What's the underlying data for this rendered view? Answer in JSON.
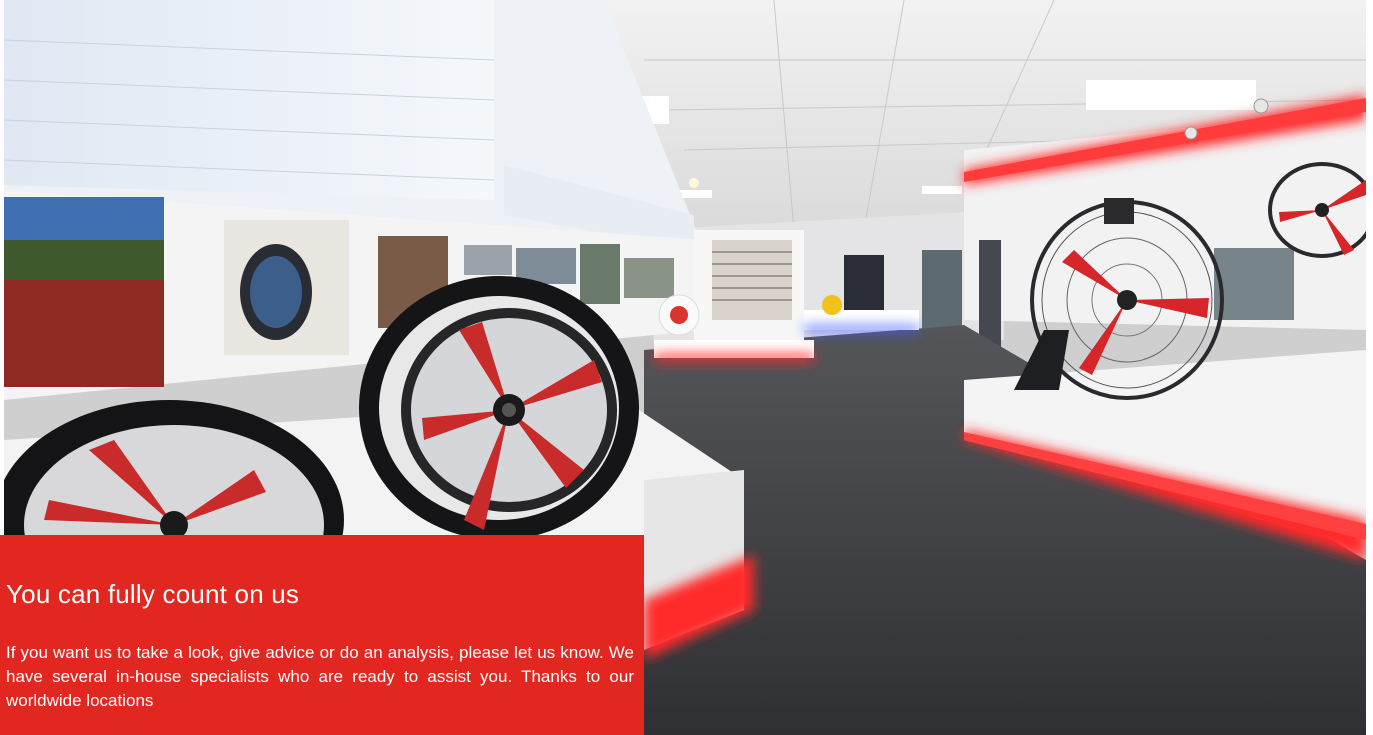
{
  "hero": {
    "image_subject": "fan-showroom-photo",
    "colors": {
      "accent_red": "#e1271f",
      "led_red": "#ff2a2a",
      "floor": "#3e3f42"
    }
  },
  "card": {
    "title": "You can fully count on us",
    "body": "If you want us to take a look, give advice or do an analysis, please let us know. We have several in-house specialists who are ready to assist you. Thanks to our worldwide locations"
  }
}
